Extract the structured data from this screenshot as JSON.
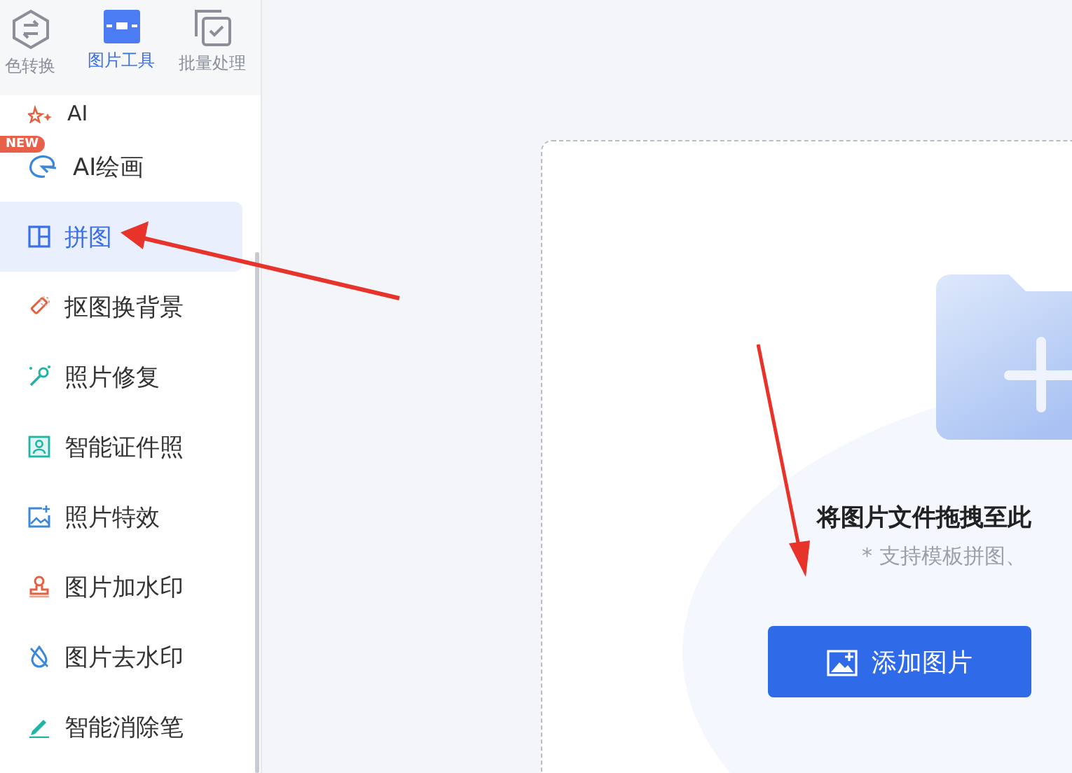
{
  "top_tools": [
    {
      "label": "色转换",
      "selected": false,
      "kind": "convert"
    },
    {
      "label": "图片工具",
      "selected": true,
      "kind": "tools"
    },
    {
      "label": "批量处理",
      "selected": false,
      "kind": "batch"
    }
  ],
  "menu": [
    {
      "label": "AI",
      "selected": false,
      "kind": "stars"
    },
    {
      "label": "AI绘画",
      "selected": false,
      "kind": "paint",
      "badge": "NEW"
    },
    {
      "label": "拼图",
      "selected": true,
      "kind": "grid"
    },
    {
      "label": "抠图换背景",
      "selected": false,
      "kind": "cutout"
    },
    {
      "label": "照片修复",
      "selected": false,
      "kind": "wand"
    },
    {
      "label": "智能证件照",
      "selected": false,
      "kind": "idphoto"
    },
    {
      "label": "照片特效",
      "selected": false,
      "kind": "effect"
    },
    {
      "label": "图片加水印",
      "selected": false,
      "kind": "stamp"
    },
    {
      "label": "图片去水印",
      "selected": false,
      "kind": "drop"
    },
    {
      "label": "智能消除笔",
      "selected": false,
      "kind": "pen"
    }
  ],
  "drop_zone": {
    "title": "将图片文件拖拽至此",
    "hint": "* 支持模板拼图、",
    "button": "添加图片"
  }
}
